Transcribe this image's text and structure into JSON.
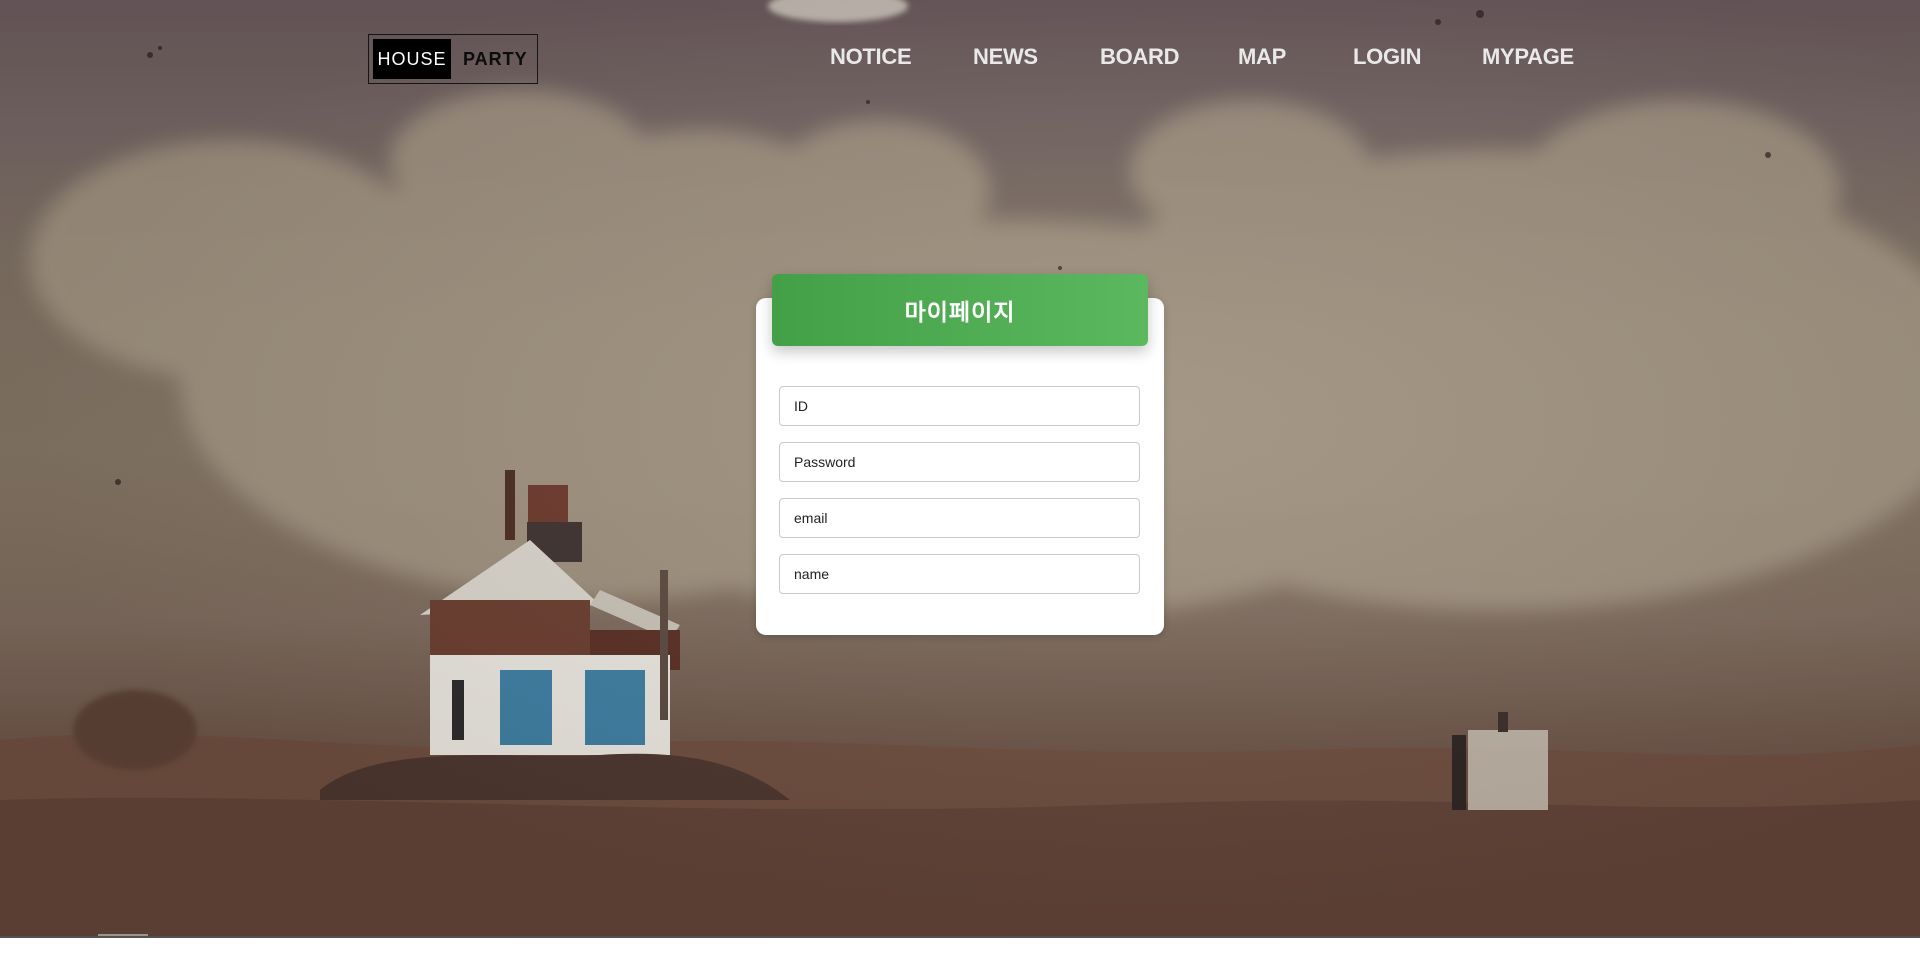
{
  "logo": {
    "left_text": "HOUSE",
    "right_text": "PARTY"
  },
  "nav": [
    {
      "label": "NOTICE"
    },
    {
      "label": "NEWS"
    },
    {
      "label": "BOARD"
    },
    {
      "label": "MAP"
    },
    {
      "label": "LOGIN"
    },
    {
      "label": "MYPAGE"
    }
  ],
  "card": {
    "title": "마이페이지",
    "fields": [
      {
        "placeholder": "ID",
        "value": ""
      },
      {
        "placeholder": "Password",
        "value": ""
      },
      {
        "placeholder": "email",
        "value": ""
      },
      {
        "placeholder": "name",
        "value": ""
      }
    ]
  },
  "colors": {
    "accent_green": "#4caf50",
    "nav_text": "#e9e9e9",
    "card_bg": "#ffffff"
  }
}
